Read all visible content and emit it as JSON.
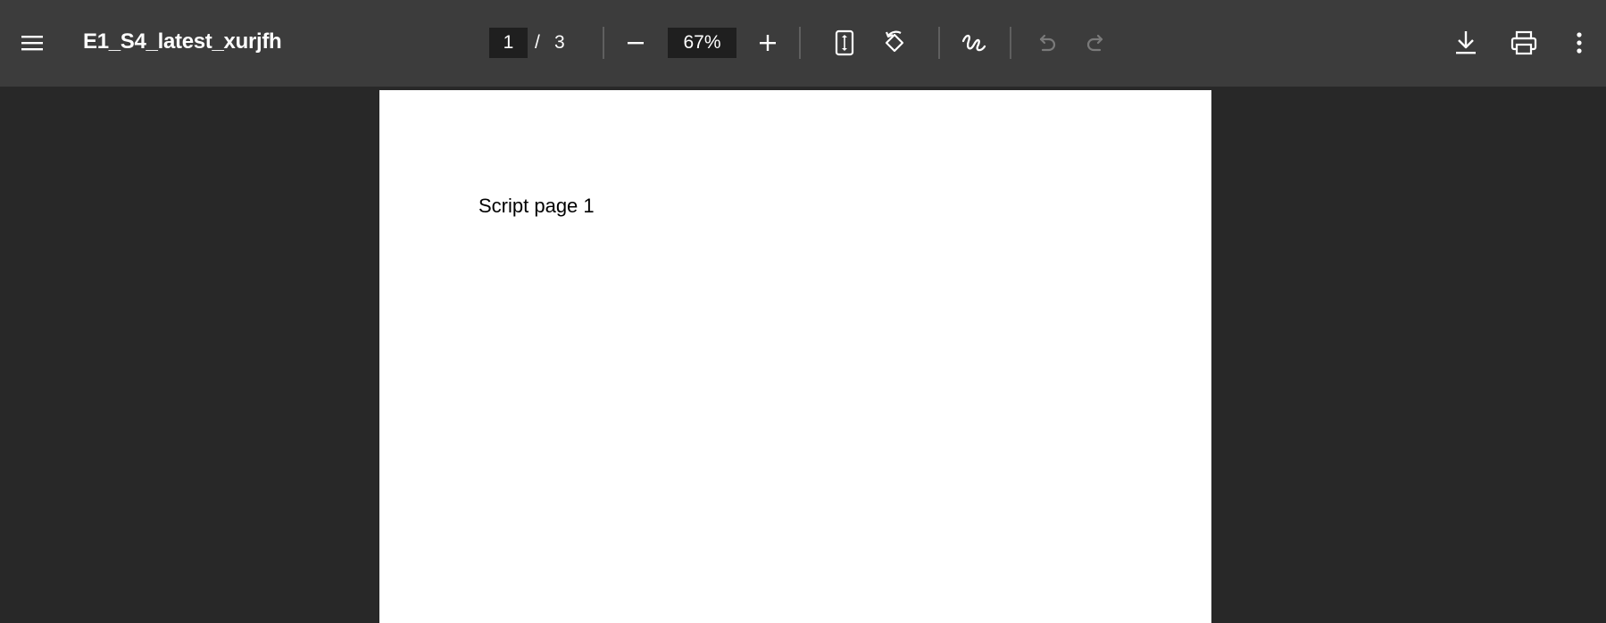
{
  "toolbar": {
    "menu_icon": "hamburger-menu-icon",
    "title": "E1_S4_latest_xurjfh",
    "page_current": "1",
    "page_separator": "/",
    "page_total": "3",
    "zoom_out_icon": "minus-icon",
    "zoom_value": "67%",
    "zoom_in_icon": "plus-icon",
    "fit_icon": "fit-to-page-icon",
    "rotate_icon": "rotate-counterclockwise-icon",
    "annotate_icon": "draw-signature-icon",
    "undo_icon": "undo-icon",
    "redo_icon": "redo-icon",
    "download_icon": "download-icon",
    "print_icon": "print-icon",
    "more_icon": "more-vertical-icon"
  },
  "document": {
    "page_text": "Script page 1"
  },
  "colors": {
    "toolbar_bg": "#3c3c3c",
    "viewer_bg": "#282828",
    "page_bg": "#ffffff",
    "input_bg": "#1f1f1f",
    "disabled_icon": "#7a7a7a"
  }
}
